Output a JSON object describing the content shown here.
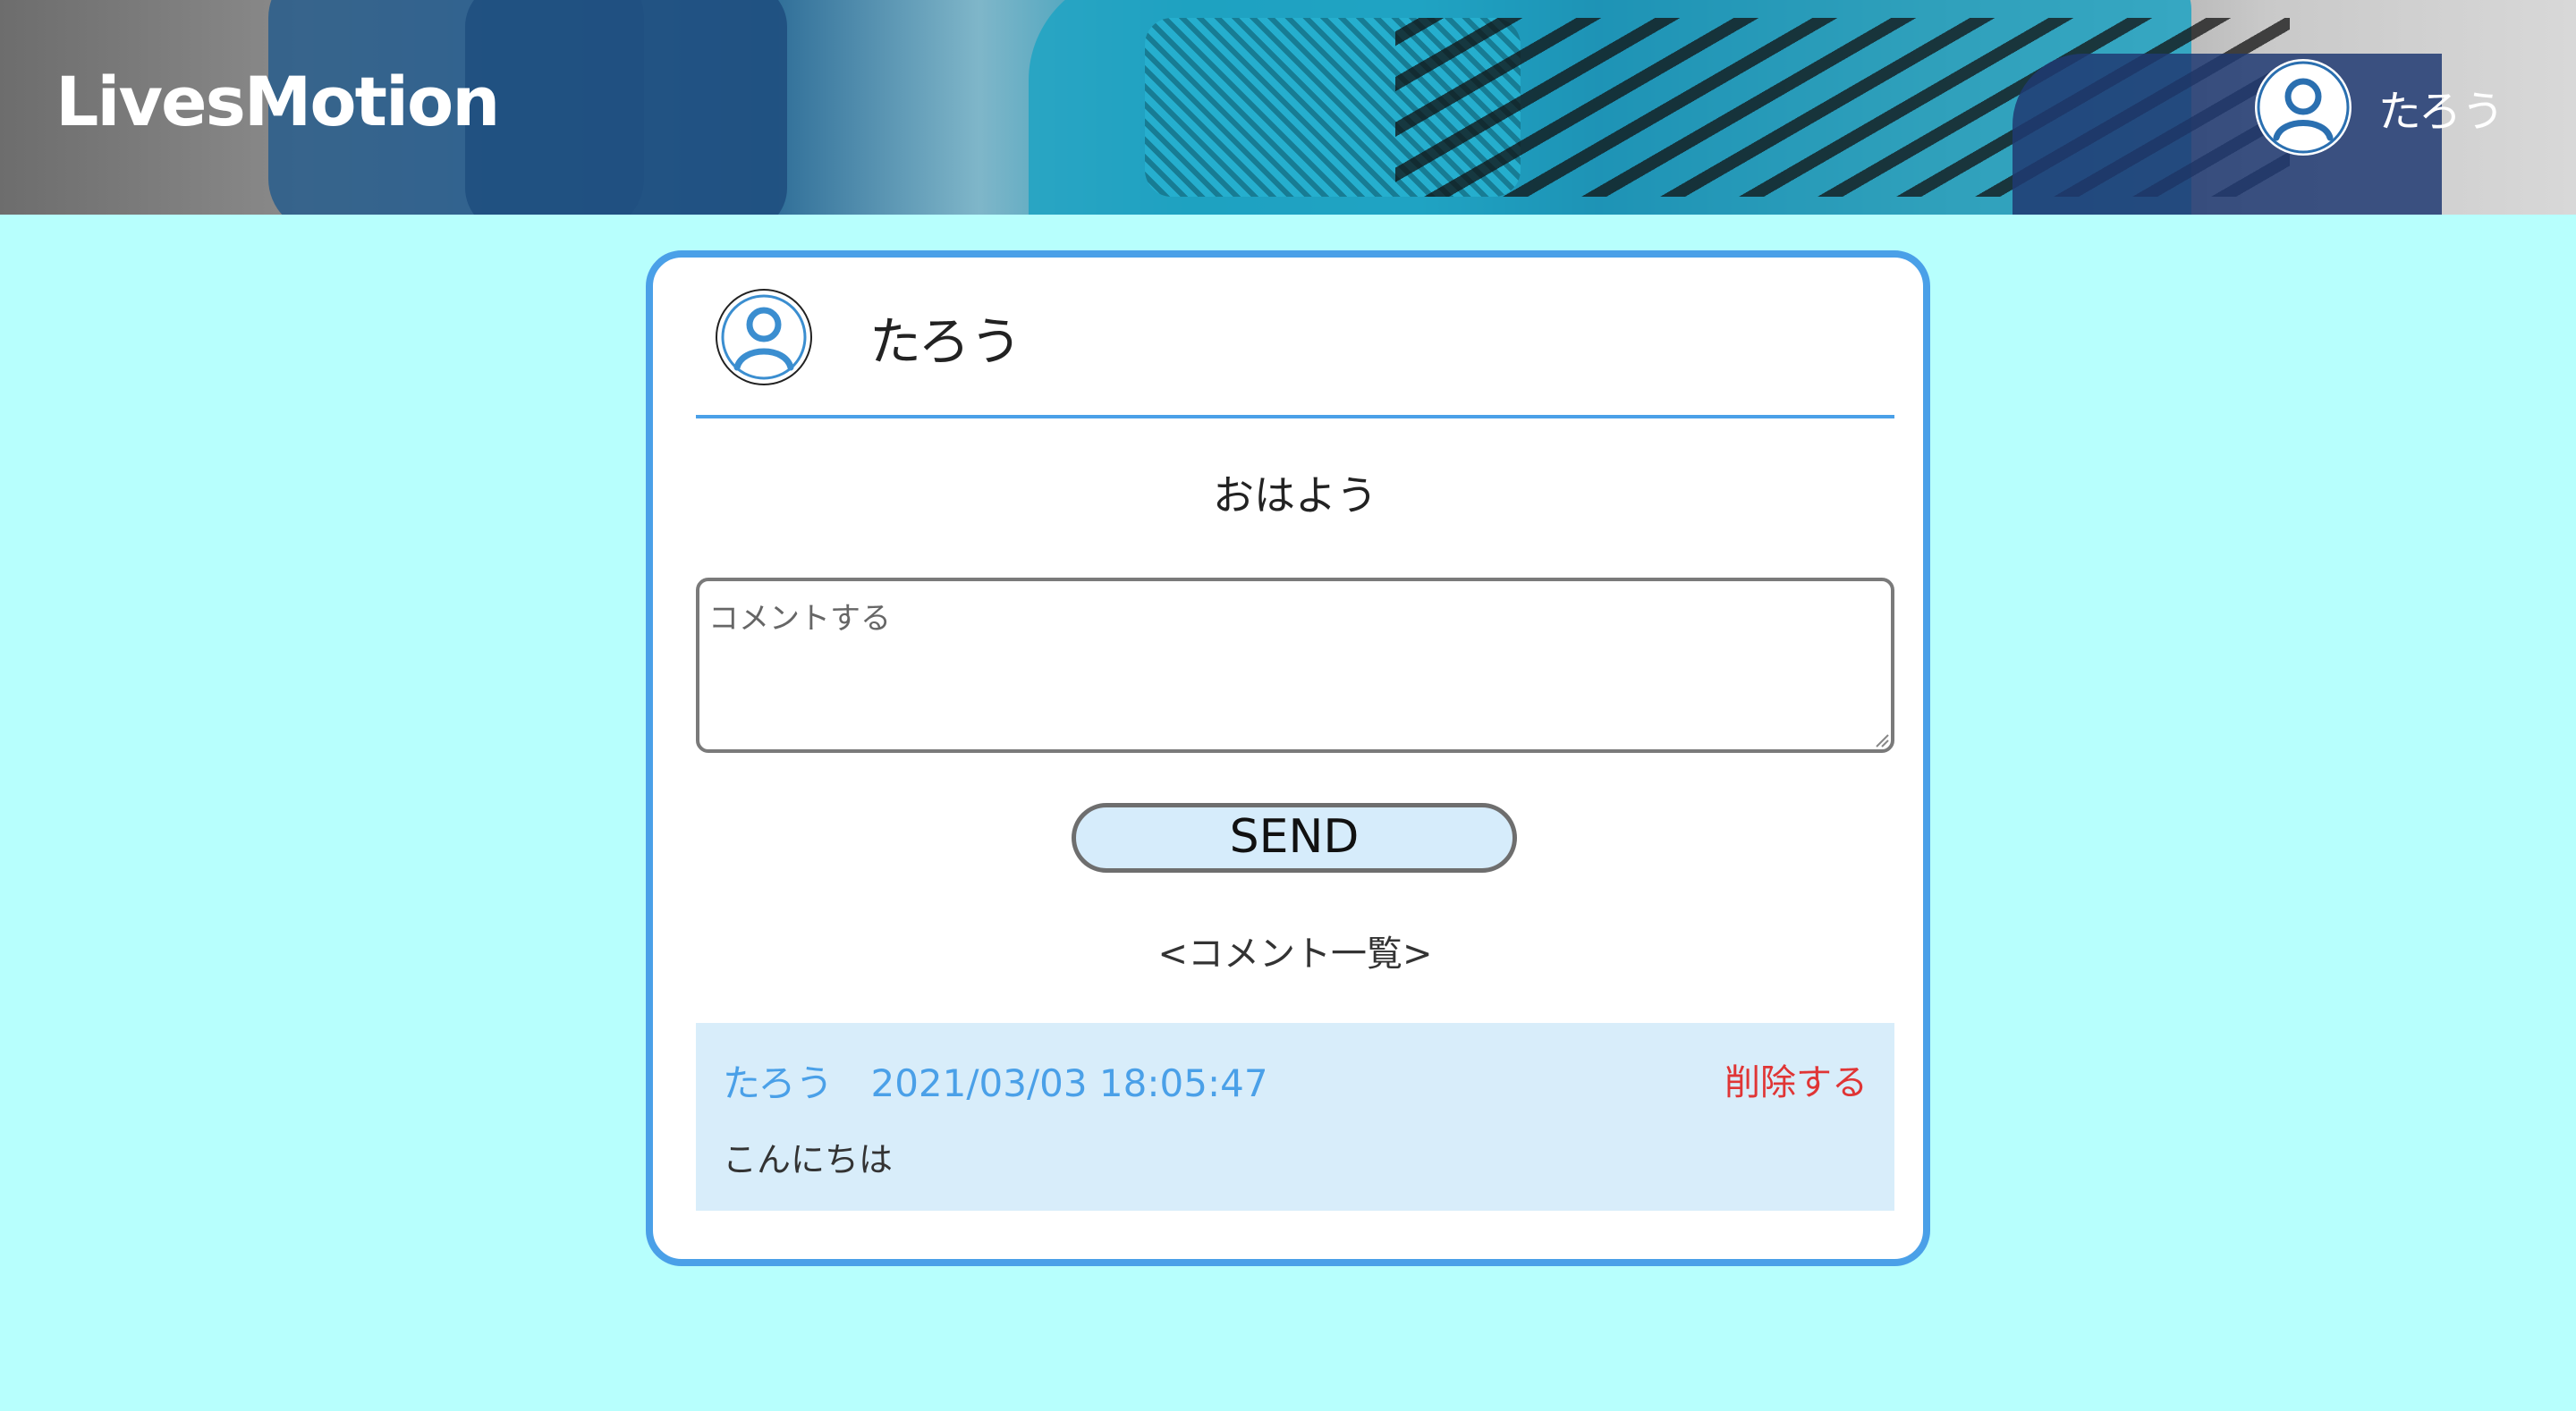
{
  "header": {
    "logo_text": "LivesMotion",
    "user_name": "たろう",
    "avatar_icon": "user-avatar-icon"
  },
  "post": {
    "author_name": "たろう",
    "text": "おはよう"
  },
  "comment_form": {
    "placeholder": "コメントする",
    "value": "",
    "send_label": "SEND"
  },
  "comments_section": {
    "heading": "<コメント一覧>",
    "items": [
      {
        "author": "たろう",
        "datetime": "2021/03/03 18:05:47",
        "delete_label": "削除する",
        "body": "こんにちは"
      }
    ]
  },
  "colors": {
    "background": "#b7fffd",
    "accent_blue": "#4aa0e8",
    "comment_bg": "#d8edfa",
    "delete_red": "#e03535",
    "send_button_bg": "#d6ecfb"
  }
}
